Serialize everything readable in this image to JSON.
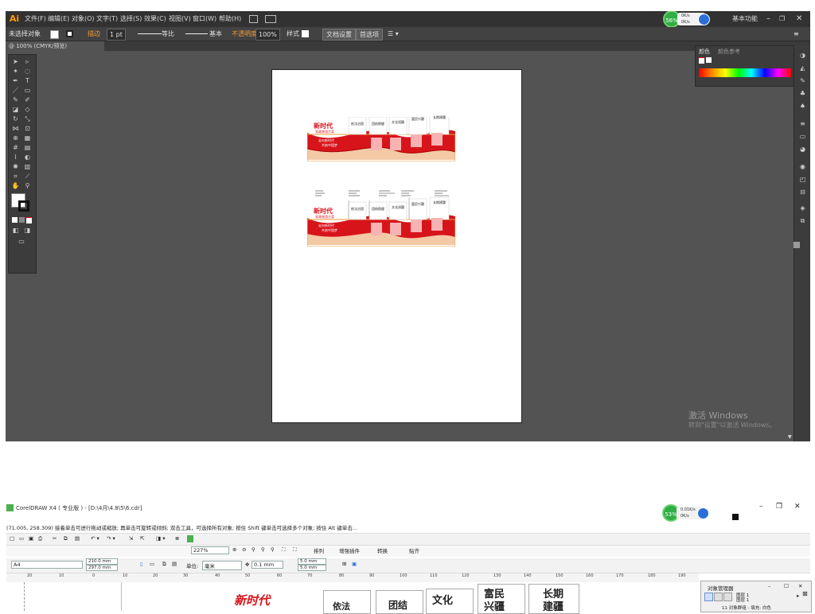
{
  "illustrator": {
    "logo": "Ai",
    "menus": [
      "文件(F)",
      "编辑(E)",
      "对象(O)",
      "文字(T)",
      "选择(S)",
      "效果(C)",
      "视图(V)",
      "窗口(W)",
      "帮助(H)"
    ],
    "workspace": "基本功能",
    "control_bar": {
      "selection": "未选择对象",
      "stroke_label": "描边",
      "stroke_weight": "1 pt",
      "uniform": "等比",
      "brush": "基本",
      "opacity_label": "不透明度",
      "opacity": "100%",
      "style_label": "样式",
      "doc_setup": "文档设置",
      "preferences": "首选项"
    },
    "doc_tab": "@ 100% (CMYK/预览)",
    "color_panel": {
      "tab1": "颜色",
      "tab2": "颜色参考"
    },
    "netspeed": {
      "percent": "56%",
      "up": "0K/s",
      "down": "0K/s"
    },
    "activate": {
      "title": "激活 Windows",
      "subtitle": "转到\"设置\"以激活 Windows。"
    }
  },
  "artwork": {
    "logo_text": "新时代",
    "banner_text": "党政旅游方案",
    "slogan_1": "走向新时代",
    "slogan_2": "共筑中国梦",
    "sections": [
      "依法治国",
      "团结稳健",
      "文化润疆",
      "富民兴疆",
      "长期建疆"
    ]
  },
  "coreldraw": {
    "title": "CorelDRAW X4 ( 专业版 ) - [D:\\4月\\4.8\\5\\6.cdr]",
    "status": "(71.005, 258.309)    接着单击可进行拖动或缩放; 再单击可旋转或倾斜; 双击工具，可选择所有对象; 按住 Shift 键单击可选择多个对象; 按住 Alt 键单击...",
    "zoom": "227%",
    "toolbar_items": [
      "排列",
      "增强插件",
      "转换",
      "贴齐"
    ],
    "page_size": "A4",
    "width": "210.0 mm",
    "height": "297.0 mm",
    "units_label": "单位:",
    "units": "毫米",
    "nudge": "0.1 mm",
    "dup_x": "5.0 mm",
    "dup_y": "5.0 mm",
    "ruler_ticks": [
      "20",
      "10",
      "0",
      "10",
      "20",
      "30",
      "40",
      "50",
      "60",
      "70",
      "80",
      "90",
      "100",
      "110",
      "120",
      "130",
      "140",
      "150",
      "160",
      "170",
      "180",
      "190",
      "200",
      "210"
    ],
    "netspeed": {
      "percent": "53%",
      "up": "0.01K/s",
      "down": "0K/s"
    },
    "object_manager": {
      "title": "对象管理器",
      "layer1": "图层 1",
      "layer2": "图层 1",
      "group": "11 对象群组 - 填充: 白色"
    },
    "canvas_text": {
      "logo": "新时代",
      "s1": "依法",
      "s2": "团结",
      "s3": "文化",
      "s4a": "富民",
      "s4b": "兴疆",
      "s5a": "长期",
      "s5b": "建疆"
    }
  },
  "colors": {
    "ai_bg": "#535353",
    "ai_dark": "#323232",
    "accent_red": "#d8141b",
    "orange": "#f29d36"
  }
}
